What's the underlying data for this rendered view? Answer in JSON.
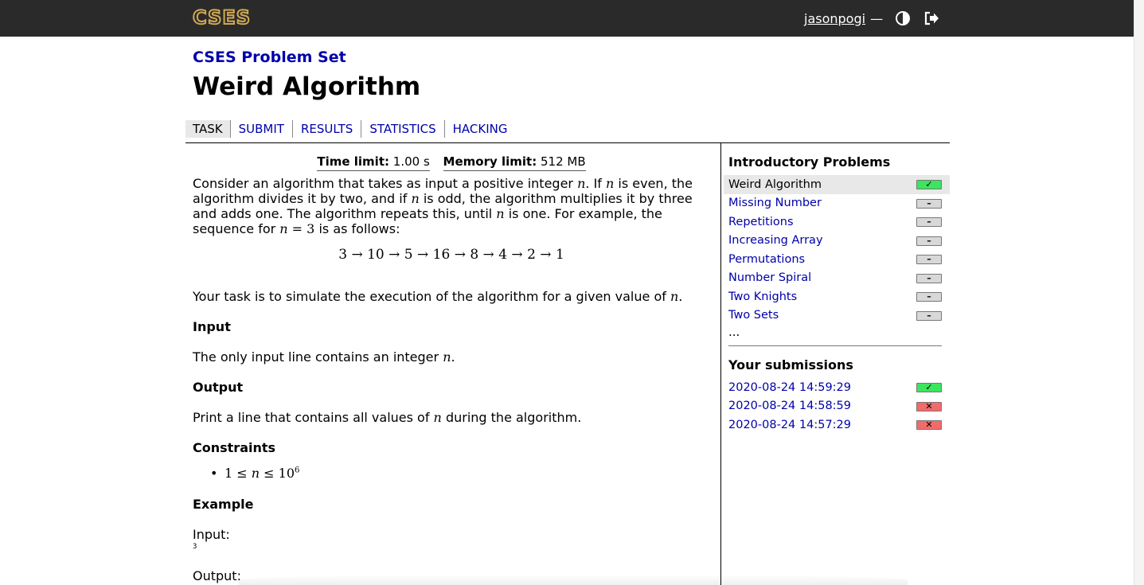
{
  "header": {
    "logo": "CSES",
    "username": "jasonpogi",
    "separator": "—",
    "theme_icon": "contrast-icon",
    "logout_icon": "logout-icon"
  },
  "breadcrumb": "CSES Problem Set",
  "title": "Weird Algorithm",
  "tabs": [
    {
      "label": "TASK",
      "active": true
    },
    {
      "label": "SUBMIT"
    },
    {
      "label": "RESULTS"
    },
    {
      "label": "STATISTICS"
    },
    {
      "label": "HACKING"
    }
  ],
  "limits": {
    "time_label": "Time limit:",
    "time_value": "1.00 s",
    "memory_label": "Memory limit:",
    "memory_value": "512 MB"
  },
  "statement": {
    "p1_a": "Consider an algorithm that takes as input a positive integer ",
    "p1_b": ". If ",
    "p1_c": " is even, the algorithm divides it by two, and if ",
    "p1_d": " is odd, the algorithm multiplies it by three and adds one. The algorithm repeats this, until ",
    "p1_e": " is one. For example, the sequence for ",
    "p1_f": " = 3",
    "p1_g": " is as follows:",
    "var": "n",
    "sequence": "3 → 10 → 5 → 16 → 8 → 4 → 2 → 1",
    "p2_a": "Your task is to simulate the execution of the algorithm for a given value of ",
    "p2_b": "."
  },
  "input_section": {
    "heading": "Input",
    "text_a": "The only input line contains an integer ",
    "text_b": "."
  },
  "output_section": {
    "heading": "Output",
    "text_a": "Print a line that contains all values of ",
    "text_b": " during the algorithm."
  },
  "constraints": {
    "heading": "Constraints",
    "item_a": "1 ≤ ",
    "item_b": " ≤ 10",
    "item_exp": "6"
  },
  "example": {
    "heading": "Example",
    "input_label": "Input:",
    "input_value": "3",
    "output_label": "Output:"
  },
  "sidebar": {
    "section_title": "Introductory Problems",
    "tasks": [
      {
        "name": "Weird Algorithm",
        "status": "accepted",
        "current": true
      },
      {
        "name": "Missing Number",
        "status": "none"
      },
      {
        "name": "Repetitions",
        "status": "none"
      },
      {
        "name": "Increasing Array",
        "status": "none"
      },
      {
        "name": "Permutations",
        "status": "none"
      },
      {
        "name": "Number Spiral",
        "status": "none"
      },
      {
        "name": "Two Knights",
        "status": "none"
      },
      {
        "name": "Two Sets",
        "status": "none"
      }
    ],
    "more": "...",
    "submissions_title": "Your submissions",
    "submissions": [
      {
        "time": "2020-08-24 14:59:29",
        "status": "accepted"
      },
      {
        "time": "2020-08-24 14:58:59",
        "status": "rejected"
      },
      {
        "time": "2020-08-24 14:57:29",
        "status": "rejected"
      }
    ]
  },
  "status_glyphs": {
    "accepted": "✓",
    "none": "–",
    "rejected": "✕"
  },
  "colors": {
    "accepted": "#3ce55e",
    "rejected": "#f26a6a",
    "none": "#d8d8d8",
    "link": "#0000aa",
    "header": "#2a2a2a",
    "logo": "#d0a951"
  }
}
